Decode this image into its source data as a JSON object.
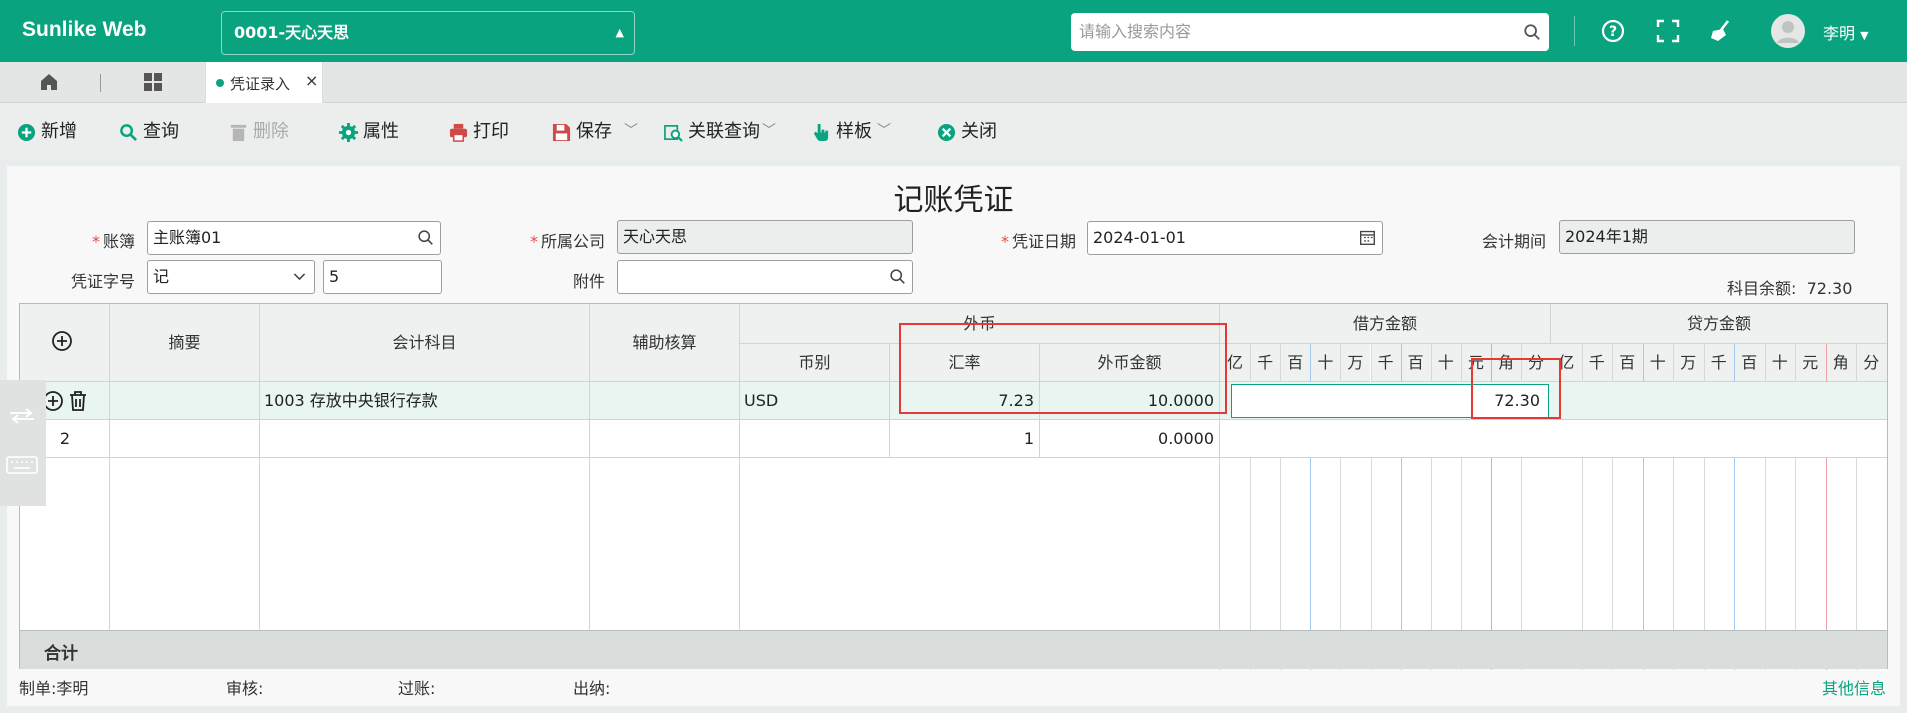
{
  "app": {
    "brand": "Sunlike Web",
    "account_select": "0001-天心天思",
    "search_placeholder": "请输入搜索内容",
    "user": "李明"
  },
  "tabs": {
    "active": "凭证录入"
  },
  "toolbar": {
    "add": "新增",
    "query": "查询",
    "delete": "删除",
    "props": "属性",
    "print": "打印",
    "save": "保存",
    "link_query": "关联查询",
    "template": "样板",
    "close": "关闭"
  },
  "form": {
    "title": "记账凭证",
    "ledger_label": "账簿",
    "ledger_value": "主账簿01",
    "company_label": "所属公司",
    "company_value": "天心天思",
    "date_label": "凭证日期",
    "date_value": "2024-01-01",
    "period_label": "会计期间",
    "period_value": "2024年1期",
    "voucher_word_label": "凭证字号",
    "voucher_word_value": "记",
    "voucher_no_value": "5",
    "attachment_label": "附件",
    "attachment_value": "",
    "balance_label": "科目余额:",
    "balance_value": "72.30"
  },
  "grid": {
    "headers": {
      "summary": "摘要",
      "account": "会计科目",
      "aux": "辅助核算",
      "fx": "外币",
      "currency": "币别",
      "rate": "汇率",
      "fx_amount": "外币金额",
      "debit": "借方金额",
      "credit": "贷方金额"
    },
    "digits": [
      "亿",
      "千",
      "百",
      "十",
      "万",
      "千",
      "百",
      "十",
      "元",
      "角",
      "分"
    ],
    "rows": [
      {
        "no": "",
        "summary": "",
        "account": "1003 存放中央银行存款",
        "aux": "",
        "currency": "USD",
        "rate": "7.23",
        "fx_amount": "10.0000",
        "debit": "72.30",
        "credit": ""
      },
      {
        "no": "2",
        "summary": "",
        "account": "",
        "aux": "",
        "currency": "",
        "rate": "1",
        "fx_amount": "0.0000",
        "debit": "",
        "credit": ""
      }
    ],
    "total_label": "合计"
  },
  "footer": {
    "maker_label": "制单:",
    "maker_value": "李明",
    "review_label": "审核:",
    "post_label": "过账:",
    "cashier_label": "出纳:",
    "other_info": "其他信息"
  },
  "colors": {
    "brand": "#0aa37f",
    "highlight": "#e53935"
  }
}
